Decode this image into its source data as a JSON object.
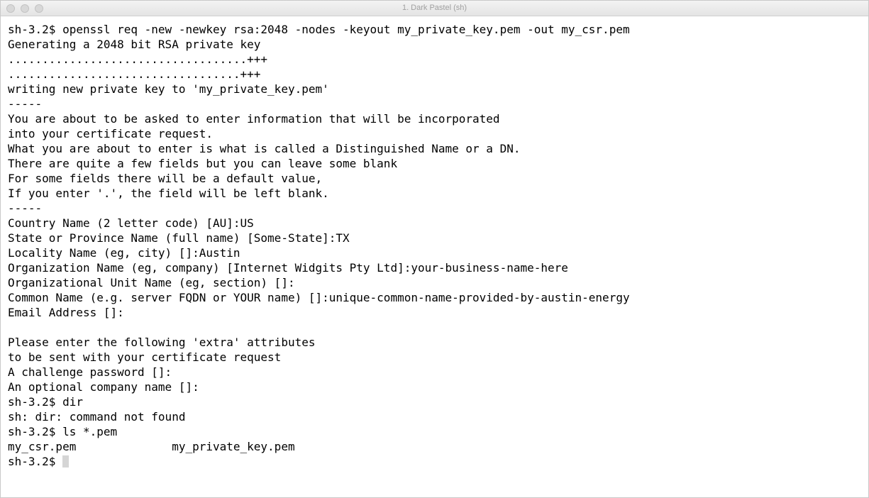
{
  "window": {
    "title": "1. Dark Pastel (sh)"
  },
  "terminal": {
    "lines": [
      "sh-3.2$ openssl req -new -newkey rsa:2048 -nodes -keyout my_private_key.pem -out my_csr.pem",
      "Generating a 2048 bit RSA private key",
      "...................................+++",
      "..................................+++",
      "writing new private key to 'my_private_key.pem'",
      "-----",
      "You are about to be asked to enter information that will be incorporated",
      "into your certificate request.",
      "What you are about to enter is what is called a Distinguished Name or a DN.",
      "There are quite a few fields but you can leave some blank",
      "For some fields there will be a default value,",
      "If you enter '.', the field will be left blank.",
      "-----",
      "Country Name (2 letter code) [AU]:US",
      "State or Province Name (full name) [Some-State]:TX",
      "Locality Name (eg, city) []:Austin",
      "Organization Name (eg, company) [Internet Widgits Pty Ltd]:your-business-name-here",
      "Organizational Unit Name (eg, section) []:",
      "Common Name (e.g. server FQDN or YOUR name) []:unique-common-name-provided-by-austin-energy",
      "Email Address []:",
      "",
      "Please enter the following 'extra' attributes",
      "to be sent with your certificate request",
      "A challenge password []:",
      "An optional company name []:",
      "sh-3.2$ dir",
      "sh: dir: command not found",
      "sh-3.2$ ls *.pem",
      "my_csr.pem              my_private_key.pem"
    ],
    "prompt": "sh-3.2$ "
  }
}
